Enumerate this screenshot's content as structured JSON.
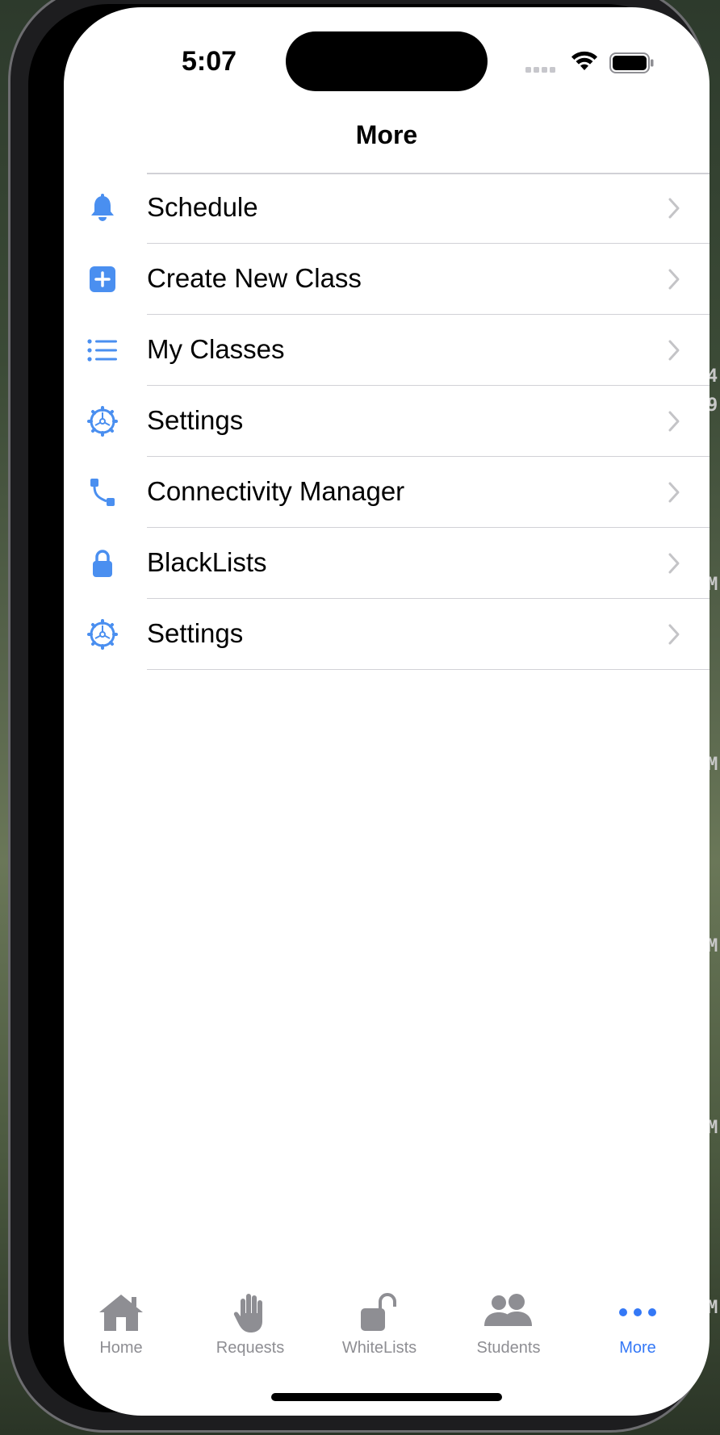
{
  "status_bar": {
    "time": "5:07"
  },
  "nav": {
    "title": "More"
  },
  "menu": {
    "items": [
      {
        "label": "Schedule",
        "icon": "bell-icon"
      },
      {
        "label": "Create New Class",
        "icon": "plus-square-icon"
      },
      {
        "label": "My Classes",
        "icon": "list-icon"
      },
      {
        "label": "Settings",
        "icon": "gear-icon"
      },
      {
        "label": "Connectivity Manager",
        "icon": "connection-icon"
      },
      {
        "label": "BlackLists",
        "icon": "lock-icon"
      },
      {
        "label": "Settings",
        "icon": "gear-icon"
      }
    ]
  },
  "tabbar": {
    "tabs": [
      {
        "label": "Home",
        "icon": "house-icon"
      },
      {
        "label": "Requests",
        "icon": "hand-icon"
      },
      {
        "label": "WhiteLists",
        "icon": "unlocked-icon"
      },
      {
        "label": "Students",
        "icon": "people-icon"
      },
      {
        "label": "More",
        "icon": "ellipsis-icon",
        "active": true
      }
    ]
  },
  "background": {
    "edge_text": [
      "4",
      "9",
      "M",
      "M",
      "M",
      "M",
      "M"
    ]
  },
  "colors": {
    "accent": "#3478f6",
    "icon_blue": "#4a8ff0",
    "inactive_gray": "#8e8e93",
    "separator": "#d1d1d6"
  }
}
